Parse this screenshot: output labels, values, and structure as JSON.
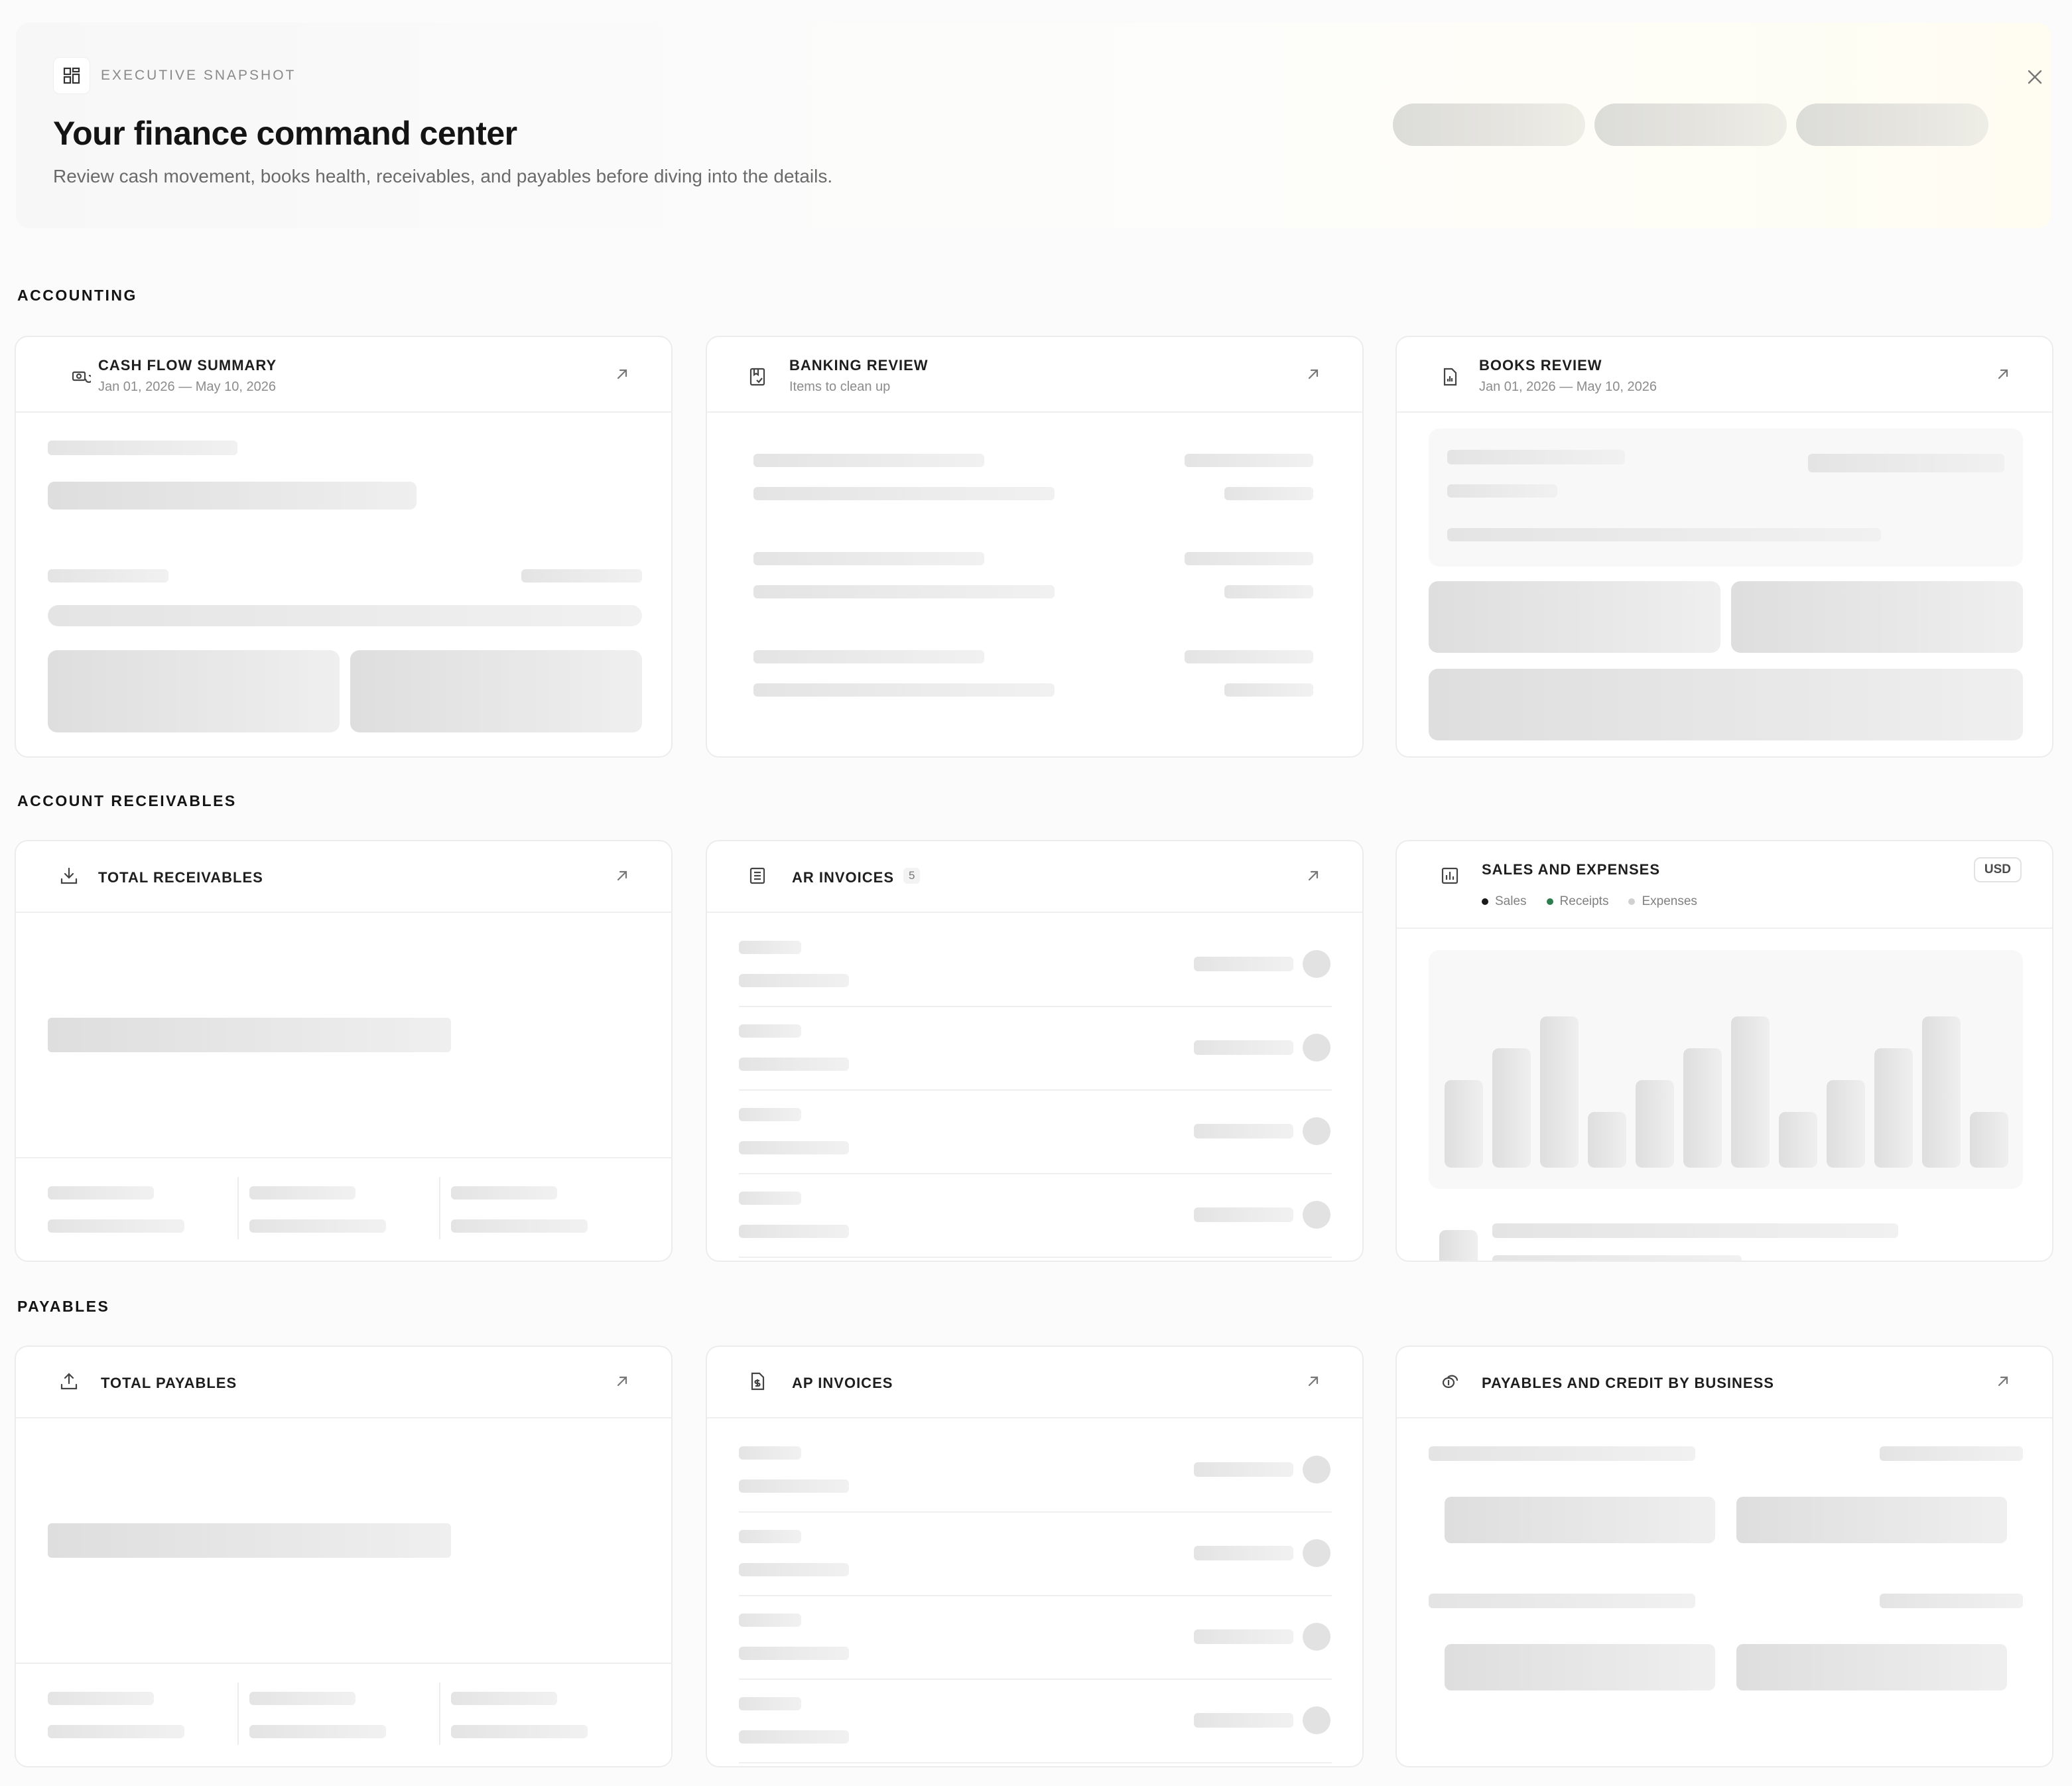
{
  "hero": {
    "eyebrow": "EXECUTIVE SNAPSHOT",
    "title": "Your finance command center",
    "subtitle": "Review cash movement, books health, receivables, and payables before diving into the details.",
    "icon": "dashboard-grid-icon",
    "close_icon": "close-icon"
  },
  "sections": {
    "accounting": "ACCOUNTING",
    "receivables": "ACCOUNT RECEIVABLES",
    "payables": "PAYABLES"
  },
  "cards": {
    "cash_flow": {
      "title": "CASH FLOW SUMMARY",
      "subtitle": "Jan 01, 2026 — May 10, 2026",
      "icon": "cash-flow-icon"
    },
    "banking_review": {
      "title": "BANKING REVIEW",
      "subtitle": "Items to clean up",
      "icon": "bank-review-icon"
    },
    "books_review": {
      "title": "BOOKS REVIEW",
      "subtitle": "Jan 01, 2026 — May 10, 2026",
      "icon": "books-report-icon"
    },
    "total_receivables": {
      "title": "TOTAL RECEIVABLES",
      "icon": "download-tray-icon"
    },
    "ar_invoices": {
      "title": "AR INVOICES",
      "count": "5",
      "icon": "invoice-list-icon"
    },
    "sales_expenses": {
      "title": "SALES AND EXPENSES",
      "currency": "USD",
      "icon": "bar-chart-icon",
      "legend": [
        {
          "label": "Sales",
          "color": "#1a1a1a"
        },
        {
          "label": "Receipts",
          "color": "#2e7d4f"
        },
        {
          "label": "Expenses",
          "color": "#d0d0d0"
        }
      ]
    },
    "total_payables": {
      "title": "TOTAL PAYABLES",
      "icon": "upload-tray-icon"
    },
    "ap_invoices": {
      "title": "AP INVOICES",
      "icon": "invoice-dollar-icon"
    },
    "payables_credit": {
      "title": "PAYABLES AND CREDIT BY BUSINESS",
      "icon": "credit-coins-icon"
    }
  },
  "colors": {
    "skeleton": "#e4e4e4",
    "card_border": "#ececec",
    "hero_warm": "#fffdf2"
  }
}
